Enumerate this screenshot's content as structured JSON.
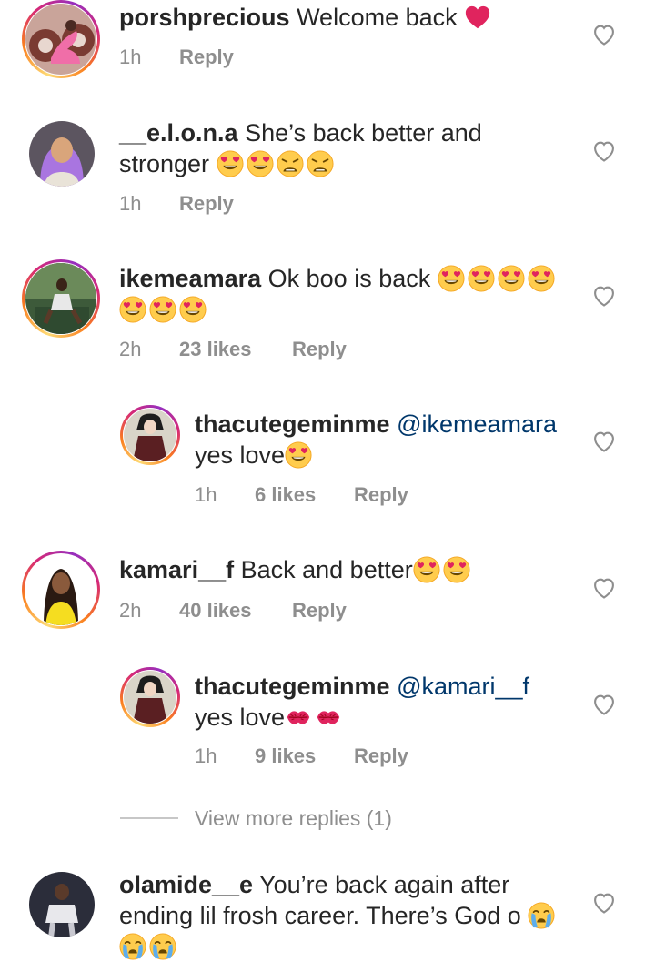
{
  "comments": [
    {
      "username": "porshprecious",
      "text": "Welcome back",
      "time": "1h",
      "likes": "",
      "reply": "Reply"
    },
    {
      "username": "__e.l.o.n.a",
      "text_line1": "She’s back better and",
      "text_line2": "stronger",
      "time": "1h",
      "likes": "",
      "reply": "Reply"
    },
    {
      "username": "ikemeamara",
      "text": "Ok boo is back",
      "time": "2h",
      "likes": "23 likes",
      "reply": "Reply"
    },
    {
      "username": "thacutegeminme",
      "mention": "@ikemeamara",
      "text": "yes love",
      "time": "1h",
      "likes": "6 likes",
      "reply": "Reply"
    },
    {
      "username": "kamari__f",
      "text": "Back and better",
      "time": "2h",
      "likes": "40 likes",
      "reply": "Reply"
    },
    {
      "username": "thacutegeminme",
      "mention": "@kamari__f",
      "text": "yes love",
      "time": "1h",
      "likes": "9 likes",
      "reply": "Reply"
    },
    {
      "username": "olamide__e",
      "text_line1": "You’re back again after",
      "text_line2": "ending lil frosh career. There’s God o"
    }
  ],
  "view_more": "View more replies (1)",
  "icons": {
    "like": "heart-outline-icon",
    "red_heart": "red-heart-emoji",
    "heart_eyes": "heart-eyes-emoji",
    "weary": "weary-face-emoji",
    "kiss": "kiss-mark-emoji",
    "crying": "loudly-crying-emoji"
  },
  "colors": {
    "text": "#262626",
    "meta": "#8e8e8e",
    "mention": "#00376b"
  }
}
